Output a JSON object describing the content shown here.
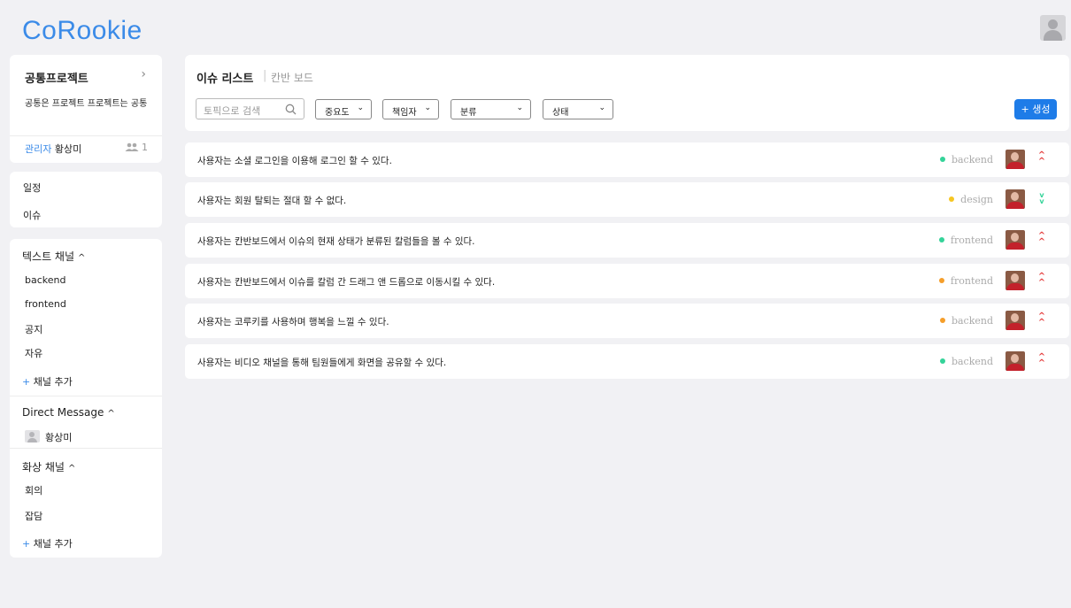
{
  "app": {
    "logo": "CoRookie"
  },
  "project": {
    "name": "공통프로젝트",
    "chevron": "›",
    "description": "공통은 프로젝트 프로젝트는 공통",
    "admin_label": "관리자",
    "admin_name": "황상미",
    "member_icon": "group-icon",
    "member_count": "1"
  },
  "nav": {
    "items": [
      {
        "label": "일정"
      },
      {
        "label": "이슈"
      }
    ]
  },
  "text_channels": {
    "title": "텍스트 채널",
    "caret": "^",
    "items": [
      {
        "label": "backend"
      },
      {
        "label": "frontend"
      },
      {
        "label": "공지"
      },
      {
        "label": "자유"
      }
    ],
    "add_label": "채널 추가",
    "add_icon": "+"
  },
  "direct_messages": {
    "title": "Direct Message",
    "caret": "^",
    "items": [
      {
        "label": "황상미"
      }
    ]
  },
  "video_channels": {
    "title": "화상 채널",
    "caret": "^",
    "items": [
      {
        "label": "회의"
      },
      {
        "label": "잡담"
      }
    ],
    "add_label": "채널 추가",
    "add_icon": "+"
  },
  "main": {
    "tabs": [
      {
        "label": "이슈 리스트",
        "active": true
      },
      {
        "label": "칸반 보드",
        "active": false
      }
    ],
    "tab_separator": "|",
    "search": {
      "placeholder": "토픽으로 검색",
      "icon": "search-icon"
    },
    "filters": [
      {
        "label": "중요도"
      },
      {
        "label": "책임자"
      },
      {
        "label": "분류"
      },
      {
        "label": "상태"
      }
    ],
    "filter_caret": "⌄",
    "create_label": "+ 생성"
  },
  "colors": {
    "accent": "#1e7ce8",
    "green": "#34d399",
    "yellow": "#f6c622",
    "orange": "#f59e2a",
    "high": "#e53e3e",
    "low": "#34d399"
  },
  "issues": [
    {
      "title": "사용자는 소셜 로그인을 이용해 로그인 할 수 있다.",
      "tag": "backend",
      "tag_color": "#34d399",
      "priority": "high",
      "priority_color": "#e53e3e"
    },
    {
      "title": "사용자는 회원 탈퇴는 절대 할 수 없다.",
      "tag": "design",
      "tag_color": "#f6c622",
      "priority": "low",
      "priority_color": "#34d399"
    },
    {
      "title": "사용자는 칸반보드에서 이슈의 현재 상태가 분류된 칼럼들을 볼 수 있다.",
      "tag": "frontend",
      "tag_color": "#34d399",
      "priority": "high",
      "priority_color": "#e53e3e"
    },
    {
      "title": "사용자는 칸반보드에서 이슈를 칼럼 간 드래그 앤 드롭으로 이동시킬 수 있다.",
      "tag": "frontend",
      "tag_color": "#f59e2a",
      "priority": "high",
      "priority_color": "#e53e3e"
    },
    {
      "title": "사용자는 코루키를 사용하며 행복을 느낄 수 있다.",
      "tag": "backend",
      "tag_color": "#f59e2a",
      "priority": "high",
      "priority_color": "#e53e3e"
    },
    {
      "title": "사용자는 비디오 채널을 통해 팀원들에게 화면을 공유할 수 있다.",
      "tag": "backend",
      "tag_color": "#34d399",
      "priority": "high",
      "priority_color": "#e53e3e"
    }
  ]
}
